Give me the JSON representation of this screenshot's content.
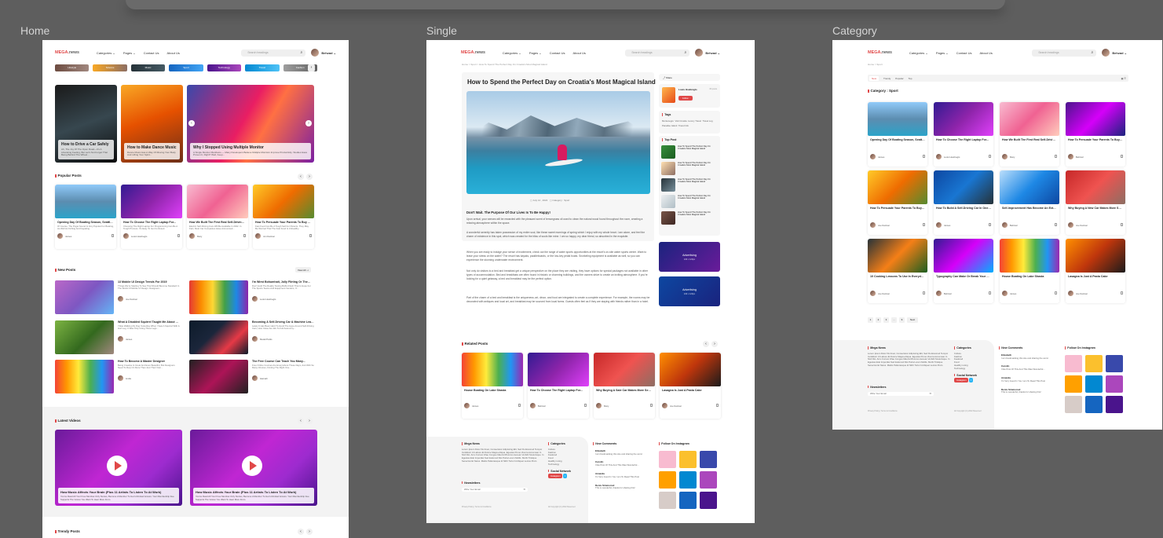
{
  "frames": {
    "home": "Home",
    "single": "Single",
    "category": "Category"
  },
  "header": {
    "logo_main": "MEGA.",
    "logo_sub": "news",
    "nav": [
      "Categories ⌄",
      "Pages ⌄",
      "Contact Us",
      "About Us"
    ],
    "search_placeholder": "Search headings",
    "user": "Behzad ⌄"
  },
  "colors": {
    "accent": "#e04848",
    "page_bg": "#5e5e5e",
    "card_bg": "#ffffff"
  },
  "home": {
    "chips": [
      "Lifestyle",
      "Science",
      "Music",
      "Sport",
      "Technology",
      "Travel",
      "Fashion"
    ],
    "hero": [
      {
        "title": "How to Drive a Car Safely",
        "desc": "Ah, The Joy Of The Open Road—It's A Liberating Feeling, But Let's Not Forget That Being Behind The Wheel..."
      },
      {
        "title": "How to Make Dance Music",
        "desc": "Dance Music Has A Way Of Moving Your Body And Lifting Your Spirit..."
      },
      {
        "title": "Why I Stopped Using Multiple Monitor",
        "desc": "A Single Monitor Manifesto — Many Developers Believe Multiple Monitors Improve Productivity. Studies Have Proven It, Right? Well, Keep..."
      }
    ],
    "popular_title": "Popular Posts",
    "popular": [
      {
        "title": "Opening Day Of Boating Season, Seattle WA",
        "desc": "Of Course, The Puget Sound Is Very Popular For Boating, As Well As Fishing And Kayaking.",
        "author": "James",
        "date": "August , 8 , 2022"
      },
      {
        "title": "How To Choose The Right Laptop For...",
        "desc": "Choosing The Right Laptop For Programming Can Be A Tough Process. It's Easy To Get Confused.",
        "author": "Louis Hoebregts",
        "date": "July 25, 2022"
      },
      {
        "title": "How We Built The First Real Self-Driving Car",
        "desc": "Electric Self-Driving Cars Will Be Available In 2022. In Fact, Most Car Companies Have Announced...",
        "author": "Mary",
        "date": "July 14 , 2022"
      },
      {
        "title": "How To Persuade Your Parents To Buy Fast...",
        "desc": "Fast Food Can Be A Tough Sell For Parents. They May Be Worried That The Fast Food Is Unhealthy.",
        "author": "Jon Kantner",
        "date": "July 27 , 2022"
      }
    ],
    "new_title": "New Posts",
    "view_all": "View All ⇢",
    "new_posts": [
      {
        "title": "13 Mobile UI Design Trends For 2019",
        "desc": "Things We're Starting To See That Should Become Standard In The World Of Mobile UI Design. Designers...",
        "author": "Joe Kantner",
        "date": "July 26, 2022"
      },
      {
        "title": "I'm Wirst Bohumhalt, Jolly Flirting Or The...",
        "desc": "Don't Hold The Reality Testing Buffet Flush That Is Hope For The Sports Teams And Equipment Vendors, If...",
        "author": "Louis Hoebregts",
        "date": "July 26, 2022"
      },
      {
        "title": "What A Disabled Squirrel Taught Me About Life...",
        "desc": "I Was Walking My Dog Yesterday When I Saw A Squirrel With A Hurt Leg. It Was Only Using Three Legs...",
        "author": "James",
        "date": "July 13, 2022"
      },
      {
        "title": "Becoming A Self-Driving Car & Machine Learning...",
        "desc": "Lately It Has Been Hard To Avoid The Hype Around Self-Driving Cars, How Close Are We To Full Autonomy...",
        "author": "Medel Parks",
        "date": "July 26, 2022"
      },
      {
        "title": "How To Become A Master Designer",
        "desc": "Being Creative Is Great And Even Beautiful, But Designers Need To Rely On More Than Just Their Own...",
        "author": "Linda",
        "date": "July 11, 2022"
      },
      {
        "title": "The Free Course Can Teach You Many...",
        "desc": "Free Online Courses Are Everywhere These Days, And With So Many Choices, Finding The Right One...",
        "author": "Hannah",
        "date": "July 24, 2022"
      }
    ],
    "videos_title": "Latest Videos",
    "videos": [
      {
        "title": "How Music Affects Your Brain (Plus 11 Artists To Listen To At Work)",
        "desc": "You've Read All Your Free Member-Only Stories, Become A Member To Get Unlimited Access. Your Membership Fee Supports The Voices You Want To Hear More From."
      },
      {
        "title": "How Music Affects Your Brain (Plus 11 Artists To Listen To At Work)",
        "desc": "You've Read All Your Free Member-Only Stories, Become A Member To Get Unlimited Access. Your Membership Fee Supports The Voices You Want To Hear More From."
      }
    ],
    "trendy_title": "Trendy Posts"
  },
  "single": {
    "breadcrumb": "Home > Sport > How To Spend The Perfect Day On Croatia's Most Magical Island",
    "title": "How to Spend the Perfect Day on Croatia's Most Magical Island",
    "date": "July 14 , 2022",
    "category": "Category : Sport",
    "heading": "Don't Wait. The Purpose Of Our Lives Is To Be Happy!",
    "paragraphs": [
      "Upon arrival, your senses will be rewarded with the pleasant scent of lemongrass oil used to clean the natural wood found throughout the room, creating a relaxing atmosphere within the space.",
      "A wonderful serenity has taken possession of my entire soul, like these sweet mornings of spring which I enjoy with my whole heart. I am alone, and feel the charm of existence in this spot, which was created for the bliss of souls like mine. I am so happy, my dear friend, so absorbed in the exquisite.",
      "When you are ready to indulge your sense of excitement, check out the range of water sports opportunities at the resort's on-site water sports center. Want to leave your stress on the water? The resort has kayaks, paddleboards, or the low-key pedal boats. Snorkeling equipment is available as well, so you can experience the stunning underwater environment.",
      "Not only do visitors to a bed and breakfast get a unique perspective on the place they are visiting, they have options for special packages not available in other types of accommodation. Bed and breakfasts are often found in historic or charming buildings, and the owners strive to create an inviting atmosphere. If you're looking for a quiet getaway, a bed and breakfast may be the perfect option.",
      "Part of the charm of a bed and breakfast is the uniqueness; art, décor, and food are integrated to create a complete experience. For example, the rooms may be decorated with antiques and local art, and breakfast may be sourced from local farms. Guests often feel as if they are staying with friends rather than in a hotel."
    ],
    "share_label": "Share",
    "author_name": "Louis Hoebregts",
    "author_count": "15 posts",
    "follow_label": "Follow",
    "tags_title": "Tags",
    "tags": [
      "Montenegro",
      "Visit Croatia",
      "Luxury Travel",
      "Travel Log",
      "Paradise Island",
      "Travel Info"
    ],
    "top_title": "Top Post",
    "top_posts": [
      "How To Spend The Perfect Day On Croatia's Most Magical Island",
      "How To Spend The Perfect Day On Croatia's Most Magical Island",
      "How To Spend The Perfect Day On Croatia's Most Magical Island",
      "How To Spend The Perfect Day On Croatia's Most Magical Island",
      "How To Spend The Perfect Day On Croatia's Most Magical Island"
    ],
    "ad_label": "Advertising",
    "ad_size": "240 x 120px",
    "related_title": "Related Posts",
    "related": [
      {
        "title": "House Boating On Lake Shasta",
        "author": "James",
        "date": "July 14, 2022"
      },
      {
        "title": "How To Choose The Right Laptop For...",
        "author": "Behzad",
        "date": "July 14, 2022"
      },
      {
        "title": "Why Buying A Sale Car Makes More Sense...",
        "author": "Mary",
        "date": "July 14, 2022"
      },
      {
        "title": "Lasagna Is Just A Pasta Cake",
        "author": "Joe Kantner",
        "date": "July 26, 2022"
      }
    ]
  },
  "category": {
    "breadcrumb": "Home > Sport",
    "pills": [
      "New",
      "Trendy",
      "Popular",
      "Top"
    ],
    "title": "Category : Sport",
    "posts": [
      {
        "title": "Opening Day Of Boating Season, Seattle WA",
        "author": "James",
        "date": "August , 8 , 2022"
      },
      {
        "title": "How To Choose The Right Laptop For...",
        "author": "Louis Hoebregts",
        "date": "July 25, 2022"
      },
      {
        "title": "How We Built The First Real Self-Driving Car",
        "author": "Mary",
        "date": "July 14 , 2022"
      },
      {
        "title": "How To Persuade Your Parents To Buy Fast...",
        "author": "Behzad",
        "date": "July 27 , 2022"
      },
      {
        "title": "How To Persuade Your Parents To Buy Fast...",
        "author": "Joe Kantner",
        "date": "May 12, 2022"
      },
      {
        "title": "How To Build A Self-Driving Car In One Month",
        "author": "James",
        "date": "July 11, 2022"
      },
      {
        "title": "Self-Improvement Has Become An Extremely...",
        "author": "Behzad",
        "date": "July 11, 2022"
      },
      {
        "title": "Why Buying A New Car Makes More Sense...",
        "author": "Joe Kantner",
        "date": "July 11, 2022"
      },
      {
        "title": "10 Cooking Lessons To Use In Everyday Life",
        "author": "Joe Kantner",
        "date": "July 11, 2022"
      },
      {
        "title": "Typography Can Make Or Break Your Design...",
        "author": "Behzad",
        "date": "July 11, 2022"
      },
      {
        "title": "House Boating On Lake Shasta",
        "author": "James",
        "date": "July 11, 2022"
      },
      {
        "title": "Lasagna Is Just A Pasta Cake",
        "author": "Joe Kantner",
        "date": "July 11, 2022"
      }
    ],
    "pager": [
      "1",
      "2",
      "3",
      "...",
      "9",
      "Next"
    ]
  },
  "footer": {
    "about_title": "Mega News",
    "about_text": "Lorem Ipsum Dolor Sit Amet, Consectetur Adipiscing Elit, Sed Do Eiusmod Tempor Incididunt Ut Labore Et Dolore Magna Aliqua. Egestas Purus Viverra Accumsan In Nisl Nisi. Arcu Cursus Vitae Congue Mauris Rhoncus Aenean Vel Elit Scelerisque. In Egestas Erat Imperdiet Sed Euismod Nisi Porta Lorem Mollis. Morbi Tristique Senectus Et Netus. Mattis Pellentesque Id Nibh Tortor Id Aliquet Lectus Proin.",
    "newsletter_title": "Newsletters",
    "newsletter_placeholder": "Write Your Email",
    "categories_title": "Categories",
    "categories": [
      "Culture",
      "Fashion",
      "Featured",
      "Food",
      "Healthy Living",
      "Technology"
    ],
    "social_title": "Social Network",
    "social_button": "Instagram",
    "comments_title": "New Comments",
    "comments": [
      {
        "name": "Elizabeth",
        "text": "I am bookmarking this site and sharing the word."
      },
      {
        "name": "Carolin",
        "text": "I like Post Of This And This Was Wonderful..."
      },
      {
        "name": "Amanda",
        "text": "I'm Very Good In You I am To Read This Post"
      },
      {
        "name": "Denis Simmonsd",
        "text": "This is wonderful, thanks for sharing this!"
      }
    ],
    "insta_title": "Follow On Instagram",
    "links": "Privacy Policy | Terms & Conditions",
    "copyright": "All Copyright (C) 2022 Reserved"
  }
}
